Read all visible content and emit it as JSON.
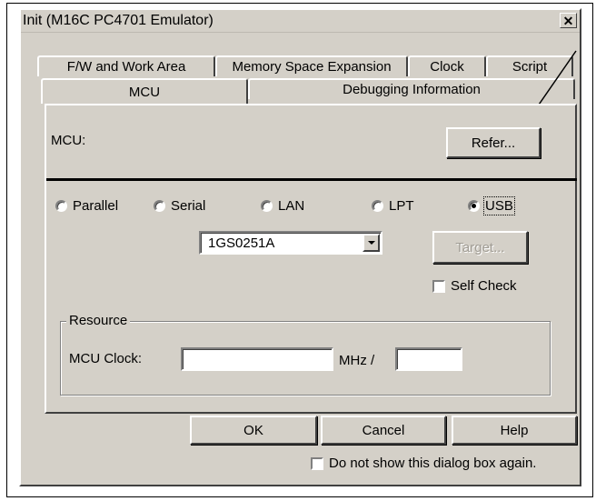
{
  "dialog": {
    "title": "Init (M16C PC4701 Emulator)",
    "close_icon": "close-icon"
  },
  "tabs": {
    "row1": [
      "F/W and Work Area",
      "Memory Space Expansion",
      "Clock",
      "Script"
    ],
    "row2": [
      "MCU",
      "Debugging Information"
    ],
    "active": "MCU"
  },
  "mcu": {
    "label": "MCU:",
    "refer_button": "Refer..."
  },
  "connection": {
    "options": [
      "Parallel",
      "Serial",
      "LAN",
      "LPT",
      "USB"
    ],
    "selected": "USB",
    "device_value": "1GS0251A",
    "target_button": "Target...",
    "self_check_label": "Self Check",
    "self_check_checked": false
  },
  "resource": {
    "group_label": "Resource",
    "mcu_clock_label": "MCU Clock:",
    "mcu_clock_value": "",
    "mhz_label": "MHz /",
    "divider_value": ""
  },
  "buttons": {
    "ok": "OK",
    "cancel": "Cancel",
    "help": "Help"
  },
  "footer": {
    "dont_show_label": "Do not show this dialog box again.",
    "dont_show_checked": false
  },
  "colors": {
    "face": "#d4d0c8",
    "highlight": "#ffffff",
    "shadow": "#404040"
  }
}
